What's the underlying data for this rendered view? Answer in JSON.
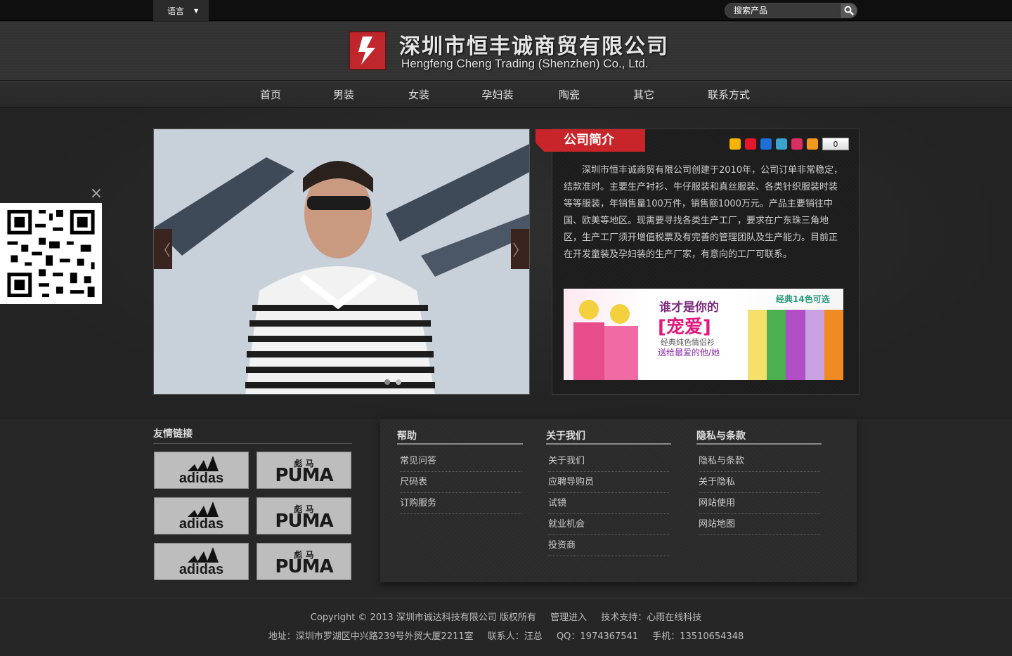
{
  "topbar": {
    "lang_label": "语言",
    "search_placeholder": "搜索产品"
  },
  "header": {
    "cn_name": "深圳市恒丰诚商贸有限公司",
    "en_name": "Hengfeng Cheng Trading (Shenzhen) Co., Ltd."
  },
  "nav": [
    "首页",
    "男装",
    "女装",
    "孕妇装",
    "陶瓷",
    "其它",
    "联系方式"
  ],
  "intro": {
    "tab_title": "公司简介",
    "share_count": "0",
    "text": "深圳市恒丰诚商贸有限公司创建于2010年，公司订单非常稳定，结款准时。主要生产衬衫、牛仔服装和真丝服装、各类针织服装时装等等服装，年销售量100万件，销售额1000万元。产品主要销往中国、欧美等地区。现需要寻找各类生产工厂，要求在广东珠三角地区，生产工厂须开增值税票及有完善的管理团队及生产能力。目前正在开发童装及孕妇装的生产厂家，有意向的工厂可联系。",
    "banner": {
      "line1": "谁才是你的",
      "line2": "[宠爱]",
      "line3": "经典纯色情侣衫",
      "line4": "送给最爱的他/她",
      "line5": "经典14色可选"
    }
  },
  "slider": {
    "prev": "〈",
    "next": "〉"
  },
  "friend_links": {
    "title": "友情链接",
    "brands": [
      {
        "word": "adidas",
        "cn": ""
      },
      {
        "word": "PUMA",
        "cn": "彪 马"
      },
      {
        "word": "adidas",
        "cn": ""
      },
      {
        "word": "PUMA",
        "cn": "彪 马"
      },
      {
        "word": "adidas",
        "cn": ""
      },
      {
        "word": "PUMA",
        "cn": "彪 马"
      }
    ]
  },
  "help": {
    "title": "帮助",
    "items": [
      "常见问答",
      "尺码表",
      "订购服务"
    ]
  },
  "about": {
    "title": "关于我们",
    "items": [
      "关于我们",
      "应聘导购员",
      "试镜",
      "就业机会",
      "投资商"
    ]
  },
  "privacy": {
    "title": "隐私与条款",
    "items": [
      "隐私与条款",
      "关于隐私",
      "网站使用",
      "网站地图"
    ]
  },
  "footer": {
    "copyright": "Copyright © 2013  深圳市诚达科技有限公司  版权所有",
    "admin": "管理进入",
    "support": "技术支持：心雨在线科技",
    "address": "地址：深圳市罗湖区中兴路239号外贸大厦2211室",
    "contact": "联系人：汪总",
    "qq": "QQ：1974367541",
    "mobile": "手机：13510654348"
  },
  "colors": {
    "accent": "#c7252a",
    "background": "#262626"
  }
}
